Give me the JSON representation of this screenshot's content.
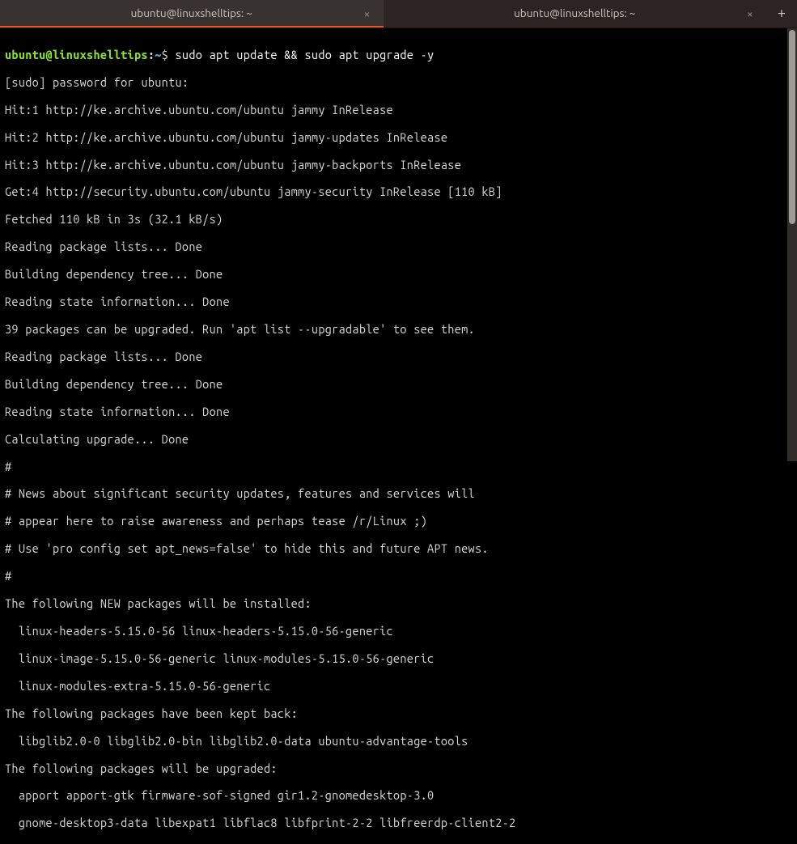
{
  "tabs": [
    {
      "title": "ubuntu@linuxshelltips: ~",
      "active": true
    },
    {
      "title": "ubuntu@linuxshelltips: ~",
      "active": false
    }
  ],
  "new_tab_glyph": "+",
  "close_glyph": "×",
  "prompt": {
    "user_host": "ubuntu@linuxshelltips",
    "sep": ":",
    "path": "~",
    "sigil": "$"
  },
  "command": "sudo apt update && sudo apt upgrade -y",
  "output_lines": [
    "[sudo] password for ubuntu:",
    "Hit:1 http://ke.archive.ubuntu.com/ubuntu jammy InRelease",
    "Hit:2 http://ke.archive.ubuntu.com/ubuntu jammy-updates InRelease",
    "Hit:3 http://ke.archive.ubuntu.com/ubuntu jammy-backports InRelease",
    "Get:4 http://security.ubuntu.com/ubuntu jammy-security InRelease [110 kB]",
    "Fetched 110 kB in 3s (32.1 kB/s)",
    "Reading package lists... Done",
    "Building dependency tree... Done",
    "Reading state information... Done",
    "39 packages can be upgraded. Run 'apt list --upgradable' to see them.",
    "Reading package lists... Done",
    "Building dependency tree... Done",
    "Reading state information... Done",
    "Calculating upgrade... Done",
    "#",
    "# News about significant security updates, features and services will",
    "# appear here to raise awareness and perhaps tease /r/Linux ;)",
    "# Use 'pro config set apt_news=false' to hide this and future APT news.",
    "#",
    "The following NEW packages will be installed:",
    "  linux-headers-5.15.0-56 linux-headers-5.15.0-56-generic",
    "  linux-image-5.15.0-56-generic linux-modules-5.15.0-56-generic",
    "  linux-modules-extra-5.15.0-56-generic",
    "The following packages have been kept back:",
    "  libglib2.0-0 libglib2.0-bin libglib2.0-data ubuntu-advantage-tools",
    "The following packages will be upgraded:",
    "  apport apport-gtk firmware-sof-signed gir1.2-gnomedesktop-3.0",
    "  gnome-desktop3-data libexpat1 libflac8 libfprint-2-2 libfreerdp-client2-2"
  ]
}
